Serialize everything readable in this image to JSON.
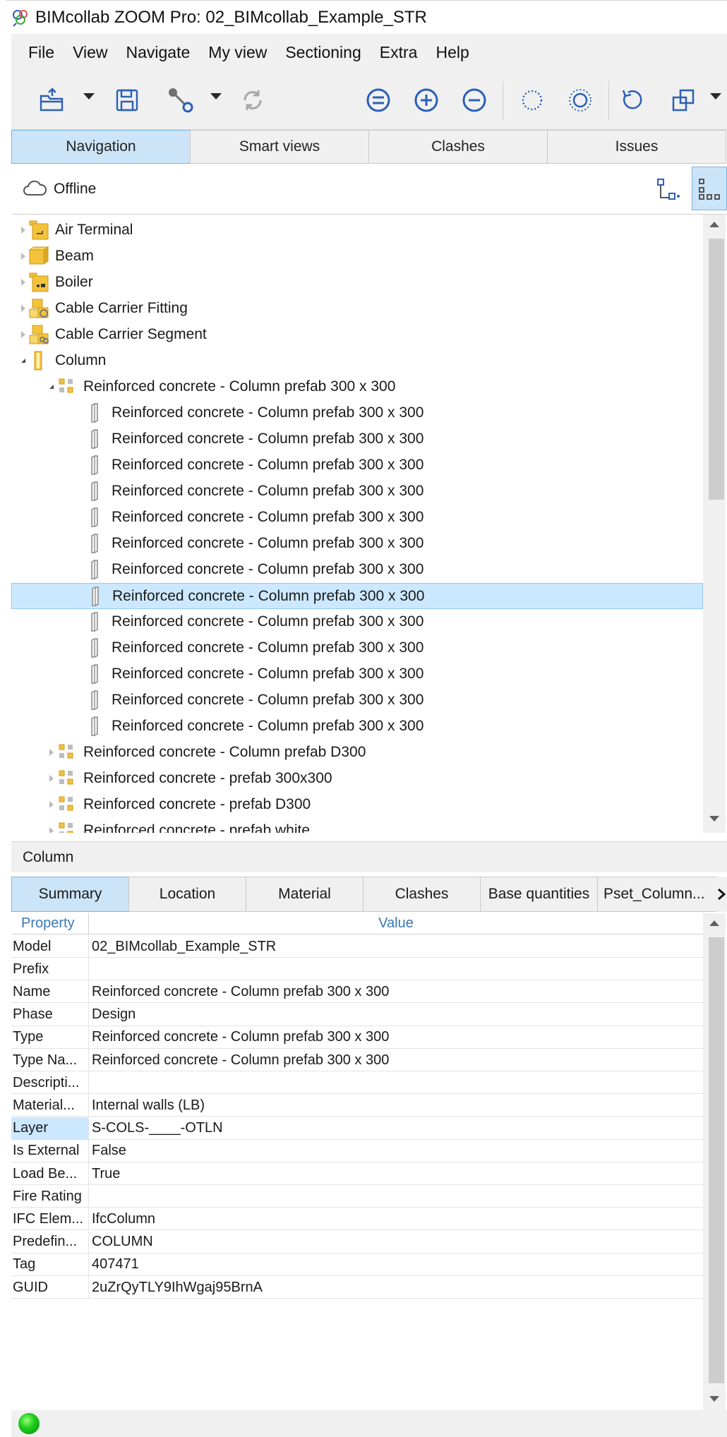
{
  "window": {
    "title": "BIMcollab ZOOM Pro: 02_BIMcollab_Example_STR"
  },
  "menu": [
    "File",
    "View",
    "Navigate",
    "My view",
    "Sectioning",
    "Extra",
    "Help"
  ],
  "toolbar": {
    "icons": [
      "open-folder-icon",
      "save-icon",
      "connect-icon",
      "sync-icon",
      "equal-circle-icon",
      "plus-circle-icon",
      "minus-circle-icon",
      "selection-ring-icon",
      "selection-ring-dashed-icon",
      "reset-rotate-icon",
      "copy-view-icon"
    ]
  },
  "main_tabs": [
    {
      "label": "Navigation",
      "active": true
    },
    {
      "label": "Smart views",
      "active": false
    },
    {
      "label": "Clashes",
      "active": false
    },
    {
      "label": "Issues",
      "active": false
    }
  ],
  "status": {
    "connection": "Offline"
  },
  "tree": [
    {
      "level": 0,
      "label": "Air Terminal",
      "expanded": false,
      "icon": "air-terminal-icon"
    },
    {
      "level": 0,
      "label": "Beam",
      "expanded": false,
      "icon": "beam-icon"
    },
    {
      "level": 0,
      "label": "Boiler",
      "expanded": false,
      "icon": "boiler-icon"
    },
    {
      "level": 0,
      "label": "Cable Carrier Fitting",
      "expanded": false,
      "icon": "cable-fitting-icon"
    },
    {
      "level": 0,
      "label": "Cable Carrier Segment",
      "expanded": false,
      "icon": "cable-segment-icon"
    },
    {
      "level": 0,
      "label": "Column",
      "expanded": true,
      "icon": "column-icon"
    },
    {
      "level": 1,
      "label": "Reinforced concrete - Column prefab 300 x 300",
      "expanded": true,
      "icon": "group-icon"
    },
    {
      "level": 2,
      "label": "Reinforced concrete - Column prefab 300 x 300",
      "icon": "column-item-icon"
    },
    {
      "level": 2,
      "label": "Reinforced concrete - Column prefab 300 x 300",
      "icon": "column-item-icon"
    },
    {
      "level": 2,
      "label": "Reinforced concrete - Column prefab 300 x 300",
      "icon": "column-item-icon"
    },
    {
      "level": 2,
      "label": "Reinforced concrete - Column prefab 300 x 300",
      "icon": "column-item-icon"
    },
    {
      "level": 2,
      "label": "Reinforced concrete - Column prefab 300 x 300",
      "icon": "column-item-icon"
    },
    {
      "level": 2,
      "label": "Reinforced concrete - Column prefab 300 x 300",
      "icon": "column-item-icon"
    },
    {
      "level": 2,
      "label": "Reinforced concrete - Column prefab 300 x 300",
      "icon": "column-item-icon"
    },
    {
      "level": 2,
      "label": "Reinforced concrete - Column prefab 300 x 300",
      "icon": "column-item-icon",
      "selected": true
    },
    {
      "level": 2,
      "label": "Reinforced concrete - Column prefab 300 x 300",
      "icon": "column-item-icon"
    },
    {
      "level": 2,
      "label": "Reinforced concrete - Column prefab 300 x 300",
      "icon": "column-item-icon"
    },
    {
      "level": 2,
      "label": "Reinforced concrete - Column prefab 300 x 300",
      "icon": "column-item-icon"
    },
    {
      "level": 2,
      "label": "Reinforced concrete - Column prefab 300 x 300",
      "icon": "column-item-icon"
    },
    {
      "level": 2,
      "label": "Reinforced concrete - Column prefab 300 x 300",
      "icon": "column-item-icon"
    },
    {
      "level": 1,
      "label": "Reinforced concrete - Column prefab D300",
      "expanded": false,
      "icon": "group-icon"
    },
    {
      "level": 1,
      "label": "Reinforced concrete - prefab 300x300",
      "expanded": false,
      "icon": "group-icon"
    },
    {
      "level": 1,
      "label": "Reinforced concrete - prefab D300",
      "expanded": false,
      "icon": "group-icon"
    },
    {
      "level": 1,
      "label": "Reinforced concrete - prefab white",
      "expanded": false,
      "icon": "group-icon"
    }
  ],
  "properties": {
    "header": "Column",
    "tabs": [
      {
        "label": "Summary",
        "active": true
      },
      {
        "label": "Location",
        "active": false
      },
      {
        "label": "Material",
        "active": false
      },
      {
        "label": "Clashes",
        "active": false
      },
      {
        "label": "Base quantities",
        "active": false
      },
      {
        "label": "Pset_Column...",
        "active": false
      }
    ],
    "columns": {
      "property": "Property",
      "value": "Value"
    },
    "rows": [
      {
        "key": "Model",
        "value": "02_BIMcollab_Example_STR"
      },
      {
        "key": "Prefix",
        "value": ""
      },
      {
        "key": "Name",
        "value": "Reinforced concrete - Column prefab 300 x 300"
      },
      {
        "key": "Phase",
        "value": "Design"
      },
      {
        "key": "Type",
        "value": "Reinforced concrete - Column prefab 300 x 300"
      },
      {
        "key": "Type Na...",
        "value": "Reinforced concrete - Column prefab 300 x 300"
      },
      {
        "key": "Descripti...",
        "value": ""
      },
      {
        "key": "Material...",
        "value": "Internal walls (LB)"
      },
      {
        "key": "Layer",
        "value": "S-COLS-____-OTLN",
        "selected": true
      },
      {
        "key": "Is External",
        "value": "False"
      },
      {
        "key": "Load Be...",
        "value": "True"
      },
      {
        "key": "Fire Rating",
        "value": ""
      },
      {
        "key": "IFC Elem...",
        "value": "IfcColumn"
      },
      {
        "key": "Predefin...",
        "value": "COLUMN"
      },
      {
        "key": "Tag",
        "value": "407471"
      },
      {
        "key": "GUID",
        "value": "2uZrQyTLY9IhWgaj95BrnA"
      }
    ]
  },
  "colors": {
    "accent_blue": "#2b5fb8",
    "tab_active": "#cce4f7",
    "selection": "#cce8ff",
    "folder_yellow": "#f5c33b",
    "status_green": "#1fcf1f"
  }
}
